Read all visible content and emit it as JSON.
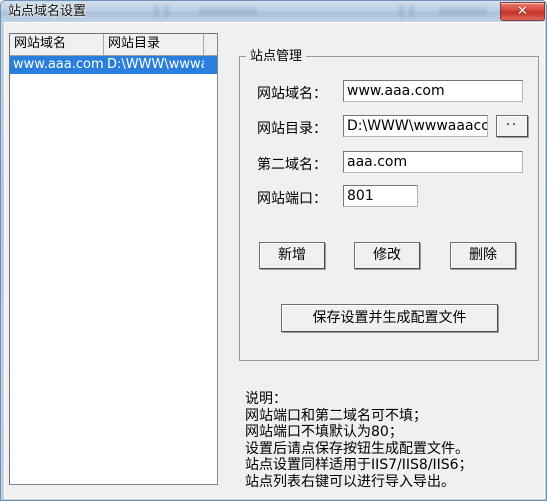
{
  "window": {
    "title": "站点域名设置",
    "close_label": "✕",
    "accent_selection": "#2a7fdd",
    "close_button_color": "#c32f26"
  },
  "listview": {
    "columns": [
      "网站域名",
      "网站目录"
    ],
    "rows": [
      {
        "domain": "www.aaa.com",
        "directory": "D:\\WWW\\wwwaaacom",
        "selected": true
      }
    ]
  },
  "groupbox": {
    "title": "站点管理",
    "fields": [
      {
        "label": "网站域名：",
        "value": "www.aaa.com"
      },
      {
        "label": "网站目录：",
        "value": "D:\\WWW\\wwwaaacom"
      },
      {
        "label": "第二域名：",
        "value": "aaa.com"
      },
      {
        "label": "网站端口：",
        "value": "801"
      }
    ],
    "browse_label": "··",
    "buttons": {
      "add": "新增",
      "edit": "修改",
      "delete": "删除",
      "save": "保存设置并生成配置文件"
    }
  },
  "notes": {
    "lines": [
      "说明：",
      "网站端口和第二域名可不填；",
      "网站端口不填默认为80；",
      "设置后请点保存按钮生成配置文件。",
      "站点设置同样适用于IIS7/IIS8/IIS6；",
      "站点列表右键可以进行导入导出。"
    ]
  }
}
